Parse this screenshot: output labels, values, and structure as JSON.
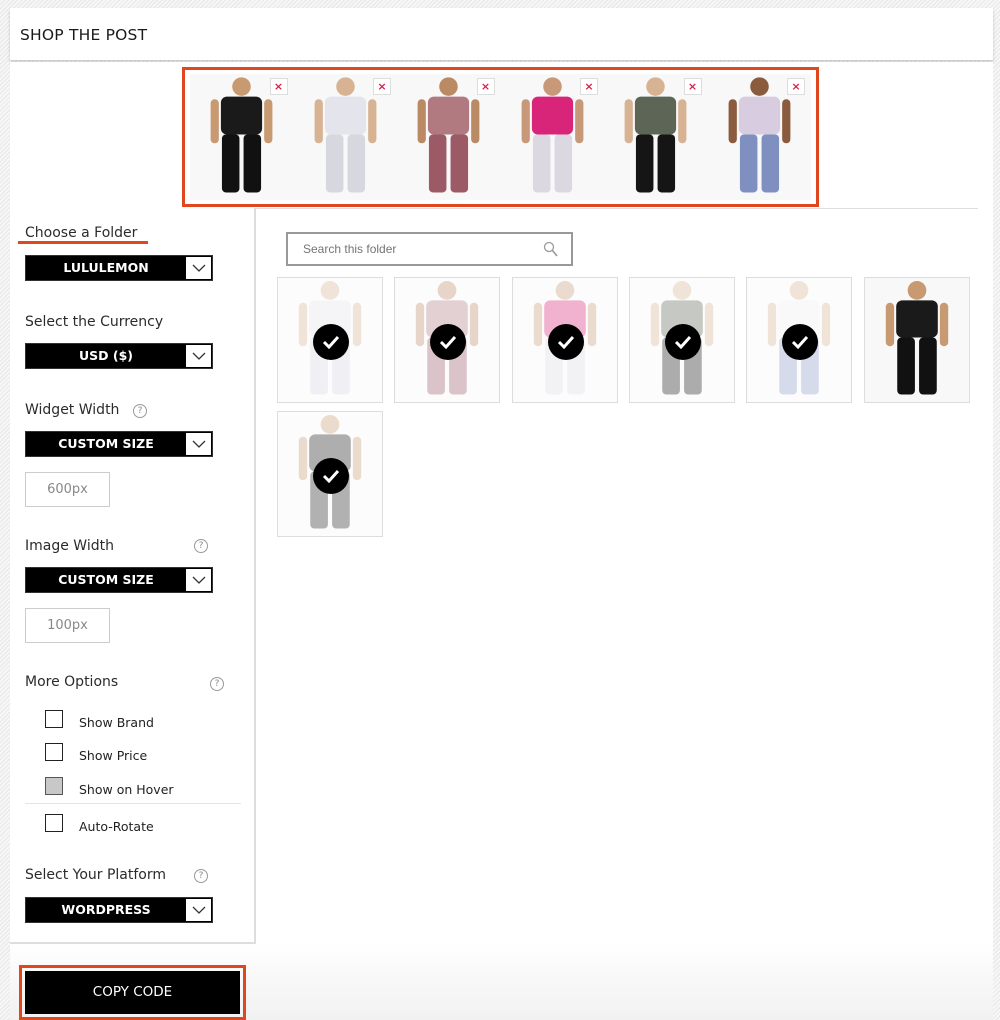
{
  "header": {
    "title": "SHOP THE POST"
  },
  "selected_strip": {
    "items": [
      {
        "name": "black-leggings",
        "remove_label": "×",
        "top": "#1a1a1a",
        "bottom": "#111111",
        "skin": "#c89a72"
      },
      {
        "name": "white-camo-set",
        "remove_label": "×",
        "top": "#e4e4ec",
        "bottom": "#d7d7e0",
        "skin": "#d7b394"
      },
      {
        "name": "floral-leggings",
        "remove_label": "×",
        "top": "#b07a80",
        "bottom": "#9b5a66",
        "skin": "#b98a64"
      },
      {
        "name": "pink-tank-shorts",
        "remove_label": "×",
        "top": "#d8257a",
        "bottom": "#dcd8e2",
        "skin": "#c89978"
      },
      {
        "name": "camo-jacket",
        "remove_label": "×",
        "top": "#5d6656",
        "bottom": "#151515",
        "skin": "#d7b394"
      },
      {
        "name": "lilac-bra-blue-leggings",
        "remove_label": "×",
        "top": "#d8cde0",
        "bottom": "#7f8fc0",
        "skin": "#8b5b3e"
      }
    ]
  },
  "sidebar": {
    "folder": {
      "label": "Choose a Folder",
      "value": "LULULEMON"
    },
    "currency": {
      "label": "Select the Currency",
      "value": "USD ($)"
    },
    "widget_width": {
      "label": "Widget Width",
      "mode": "CUSTOM SIZE",
      "value": "600px",
      "help": "?"
    },
    "image_width": {
      "label": "Image Width",
      "mode": "CUSTOM SIZE",
      "value": "100px",
      "help": "?"
    },
    "more_options": {
      "label": "More Options",
      "help": "?",
      "items": [
        {
          "label": "Show Brand",
          "checked": false
        },
        {
          "label": "Show Price",
          "checked": false
        },
        {
          "label": "Show on Hover",
          "checked": false,
          "disabled": true
        },
        {
          "label": "Auto-Rotate",
          "checked": false
        }
      ]
    },
    "platform": {
      "label": "Select Your Platform",
      "value": "WORDPRESS",
      "help": "?"
    },
    "copy_button": "COPY CODE"
  },
  "folder_view": {
    "search_placeholder": "Search this folder",
    "products": [
      {
        "name": "white-camo-set",
        "selected": true,
        "top": "#e4e4ec",
        "bottom": "#d7d7e0",
        "skin": "#d7b394"
      },
      {
        "name": "floral-leggings",
        "selected": true,
        "top": "#b07a80",
        "bottom": "#9b5a66",
        "skin": "#b98a64"
      },
      {
        "name": "pink-tank-shorts",
        "selected": true,
        "top": "#d8257a",
        "bottom": "#dcd8e2",
        "skin": "#c89978"
      },
      {
        "name": "camo-jacket",
        "selected": true,
        "top": "#5d6656",
        "bottom": "#151515",
        "skin": "#d7b394"
      },
      {
        "name": "white-bra-blue-leggings",
        "selected": true,
        "top": "#f0f0f0",
        "bottom": "#8d9bc8",
        "skin": "#d7b394"
      },
      {
        "name": "black-leggings",
        "selected": false,
        "top": "#1a1a1a",
        "bottom": "#111111",
        "skin": "#c89a72"
      },
      {
        "name": "black-leggings-2",
        "selected": true,
        "top": "#1a1a1a",
        "bottom": "#222222",
        "skin": "#c89a72"
      }
    ]
  },
  "colors": {
    "accent": "#e0471f",
    "remove": "#d6204b"
  }
}
